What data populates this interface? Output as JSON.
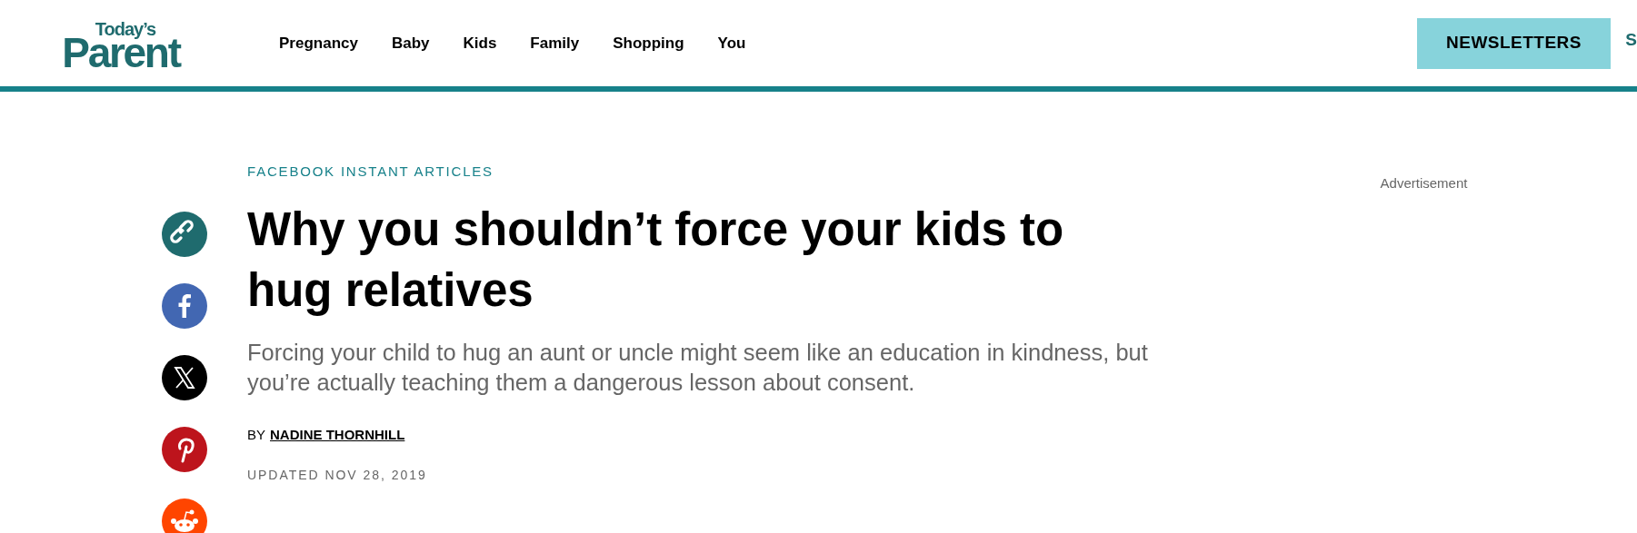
{
  "logo": {
    "top": "Today’s",
    "main": "Parent"
  },
  "nav": [
    "Pregnancy",
    "Baby",
    "Kids",
    "Family",
    "Shopping",
    "You"
  ],
  "newsletters_button": "NEWSLETTERS",
  "cut_nav_item": "S",
  "share_buttons": [
    {
      "kind": "link",
      "color": "#1f6b6e"
    },
    {
      "kind": "facebook",
      "color": "#4267b2"
    },
    {
      "kind": "x",
      "color": "#000000"
    },
    {
      "kind": "pinterest",
      "color": "#bd141c"
    },
    {
      "kind": "reddit",
      "color": "#ff4500"
    }
  ],
  "article": {
    "category": "FACEBOOK INSTANT ARTICLES",
    "title": "Why you shouldn’t force your kids to hug relatives",
    "dek": "Forcing your child to hug an aunt or uncle might seem like an education in kindness, but you’re actually teaching them a dangerous lesson about consent.",
    "byline_prefix": "BY",
    "author": "NADINE THORNHILL",
    "updated": "UPDATED NOV 28, 2019"
  },
  "ad_label": "Advertisement"
}
